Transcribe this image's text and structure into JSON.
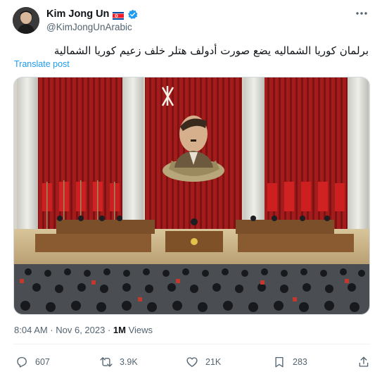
{
  "author": {
    "display_name": "Kim Jong Un",
    "handle": "@KimJongUnArabic",
    "flag_icon": "north-korea-flag-icon",
    "verified_icon": "verified-badge-icon"
  },
  "tweet": {
    "text": "برلمان كوريا الشماليه يضع صورت أدولف هتلر خلف زعيم كوريا الشمالية",
    "translate_label": "Translate post"
  },
  "meta": {
    "time": "8:04 AM · Nov 6, 2023 · ",
    "views_count": "1M",
    "views_label": " Views"
  },
  "actions": {
    "replies": "607",
    "reposts": "3.9K",
    "likes": "21K",
    "bookmarks": "283"
  },
  "colors": {
    "accent": "#1d9bf0",
    "text": "#0f1419",
    "secondary": "#536471"
  }
}
